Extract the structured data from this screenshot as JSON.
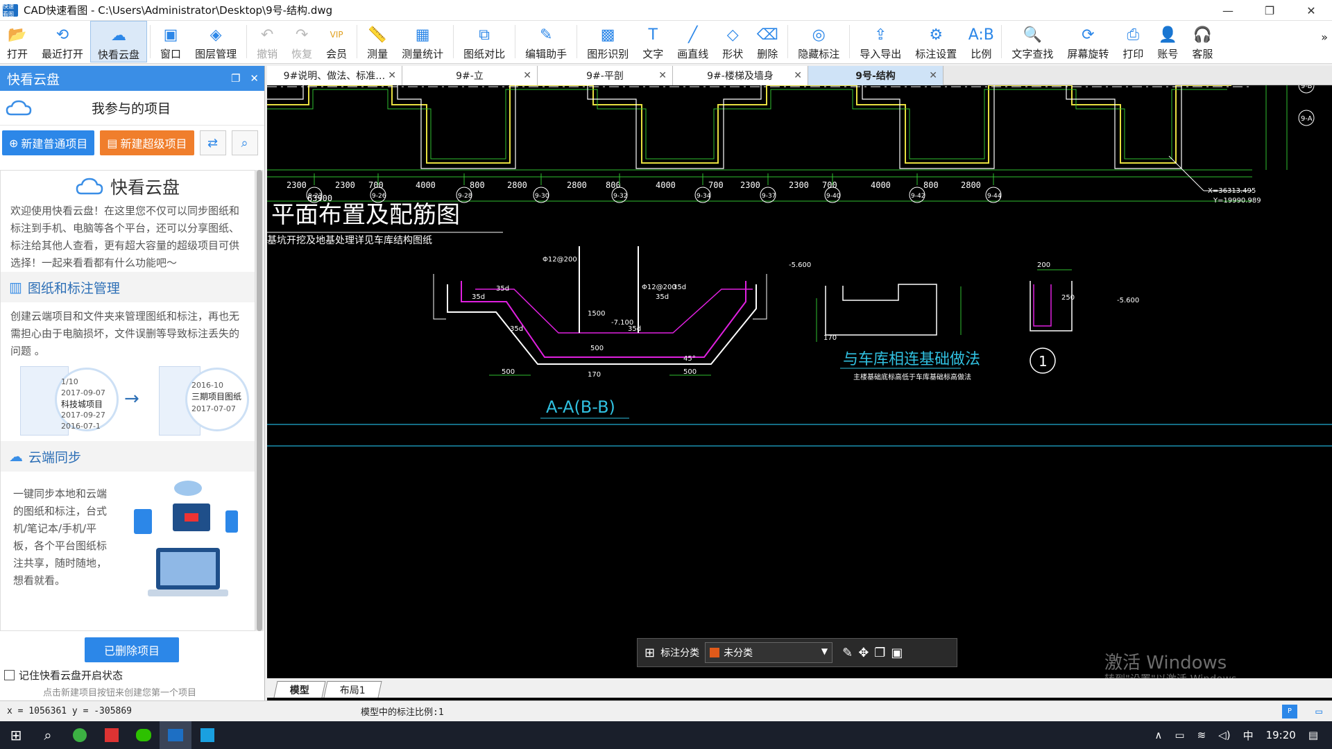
{
  "window": {
    "title": "CAD快速看图 - C:\\Users\\Administrator\\Desktop\\9号-结构.dwg",
    "app_icon_text": "快速看图"
  },
  "toolbar": {
    "items": [
      {
        "label": "打开",
        "icon": "folder-open-icon"
      },
      {
        "label": "最近打开",
        "icon": "history-icon"
      },
      {
        "label": "快看云盘",
        "icon": "cloud-icon"
      },
      {
        "label": "窗口",
        "icon": "window-icon"
      },
      {
        "label": "图层管理",
        "icon": "layers-icon"
      },
      {
        "label": "撤销",
        "icon": "undo-icon"
      },
      {
        "label": "恢复",
        "icon": "redo-icon"
      },
      {
        "label": "会员",
        "icon": "vip-icon"
      },
      {
        "label": "测量",
        "icon": "ruler-icon"
      },
      {
        "label": "测量统计",
        "icon": "measure-stats-icon"
      },
      {
        "label": "图纸对比",
        "icon": "compare-icon"
      },
      {
        "label": "编辑助手",
        "icon": "edit-assistant-icon"
      },
      {
        "label": "图形识别",
        "icon": "shape-recognize-icon"
      },
      {
        "label": "文字",
        "icon": "text-icon"
      },
      {
        "label": "画直线",
        "icon": "line-icon"
      },
      {
        "label": "形状",
        "icon": "shape-icon"
      },
      {
        "label": "删除",
        "icon": "eraser-icon"
      },
      {
        "label": "隐藏标注",
        "icon": "hide-icon"
      },
      {
        "label": "导入导出",
        "icon": "import-export-icon"
      },
      {
        "label": "标注设置",
        "icon": "settings-icon"
      },
      {
        "label": "比例",
        "icon": "scale-icon"
      },
      {
        "label": "文字查找",
        "icon": "text-search-icon"
      },
      {
        "label": "屏幕旋转",
        "icon": "rotate-screen-icon"
      },
      {
        "label": "打印",
        "icon": "print-icon"
      },
      {
        "label": "账号",
        "icon": "account-icon"
      },
      {
        "label": "客服",
        "icon": "headset-icon"
      }
    ],
    "more": "»"
  },
  "panel": {
    "title": "快看云盘",
    "project_header": "我参与的项目",
    "new_normal": "新建普通项目",
    "new_super": "新建超级项目",
    "intro_title": "快看云盘",
    "intro_text": "欢迎使用快看云盘！在这里您不仅可以同步图纸和标注到手机、电脑等各个平台，还可以分享图纸、标注给其他人查看，更有超大容量的超级项目可供选择！一起来看看都有什么功能吧～",
    "sec1_title": "图纸和标注管理",
    "sec1_text": "创建云端项目和文件夹来管理图纸和标注，再也无需担心由于电脑损坏，文件误删等导致标注丢失的问题 。",
    "sec1_img_a": [
      "1/10",
      "2017-09-07",
      "科技城项目",
      "2017-09-27",
      "2016-07-1"
    ],
    "sec1_img_b": [
      "2016-10",
      "三期项目图纸",
      "2017-07-07"
    ],
    "sec2_title": "云端同步",
    "sec2_text": "一键同步本地和云端的图纸和标注，台式机/笔记本/手机/平板，各个平台图纸标注共享，随时随地，想看就看。",
    "deleted_btn": "已删除项目",
    "remember_label": "记住快看云盘开启状态",
    "hint": "点击新建项目按钮来创建您第一个项目"
  },
  "doc_tabs": [
    {
      "label": "9#说明、做法、标准…",
      "active": false
    },
    {
      "label": "9#-立",
      "active": false
    },
    {
      "label": "9#-平剖",
      "active": false
    },
    {
      "label": "9#-楼梯及墙身",
      "active": false
    },
    {
      "label": "9号-结构",
      "active": true
    }
  ],
  "drawing": {
    "dims_top": [
      "2300",
      "2300",
      "700",
      "4000",
      "800",
      "2800",
      "2800",
      "800",
      "4000",
      "700",
      "2300",
      "2300",
      "700",
      "4000",
      "800",
      "2800"
    ],
    "total_dim": "63900",
    "axes": [
      "9-23",
      "9-26",
      "9-28",
      "9-30",
      "9-32",
      "9-34",
      "9-37",
      "9-40",
      "9-42",
      "9-44"
    ],
    "side_axes": [
      "9-B",
      "9-A"
    ],
    "coord_x": "X=36313.495",
    "coord_y": "Y=19990.989",
    "title_main": "平面布置及配筋图",
    "title_sub": "基坑开挖及地基处理详见车库结构图纸",
    "section_label": "A-A(B-B)",
    "section_dims": [
      "500",
      "500",
      "1500",
      "500",
      "170",
      "-7.100",
      "-5.600",
      "-5.600",
      "200",
      "250",
      "170",
      "45°"
    ],
    "rebar_notes": [
      "Φ12@200",
      "Φ12@200",
      "35d",
      "35d",
      "35d",
      "35d",
      "35d",
      "35d"
    ],
    "detail_title": "与车库相连基础做法",
    "detail_sub": "主楼基础底标高低于车库基础标高做法",
    "circle_label": "1"
  },
  "floatbar": {
    "label": "标注分类",
    "selected": "未分类"
  },
  "layout_tabs": [
    {
      "label": "模型",
      "active": true
    },
    {
      "label": "布局1",
      "active": false
    }
  ],
  "status": {
    "coords": "x = 1056361  y = -305869",
    "scale": "模型中的标注比例:1"
  },
  "watermark": {
    "line1": "激活 Windows",
    "line2": "转到\"设置\"以激活 Windows。"
  },
  "taskbar": {
    "time": "19:20",
    "ime": "中"
  },
  "colors": {
    "accent": "#3a8ee6",
    "orange": "#f07e2c",
    "canvas_bg": "#000000",
    "cad_yellow": "#e8e040",
    "cad_green": "#2fd02f",
    "cad_magenta": "#e020e0",
    "cad_cyan": "#30c0e0"
  }
}
